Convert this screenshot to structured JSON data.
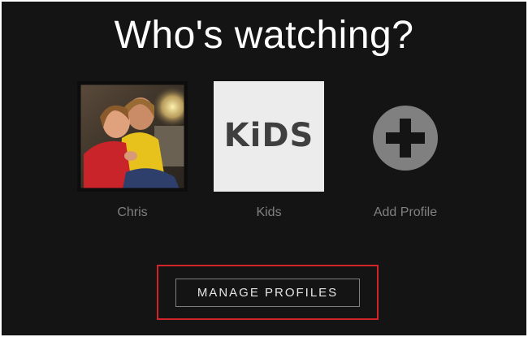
{
  "page": {
    "title": "Who's watching?"
  },
  "profiles": [
    {
      "name": "Chris",
      "avatar": "family-photo"
    },
    {
      "name": "Kids",
      "avatar": "kids-logo",
      "logo_text": "KiDS"
    },
    {
      "name": "Add Profile",
      "avatar": "plus-circle-icon"
    }
  ],
  "manage": {
    "label": "MANAGE PROFILES",
    "highlight_color": "#d12428"
  },
  "colors": {
    "background": "#141414",
    "label": "#808080",
    "title": "#ffffff"
  }
}
